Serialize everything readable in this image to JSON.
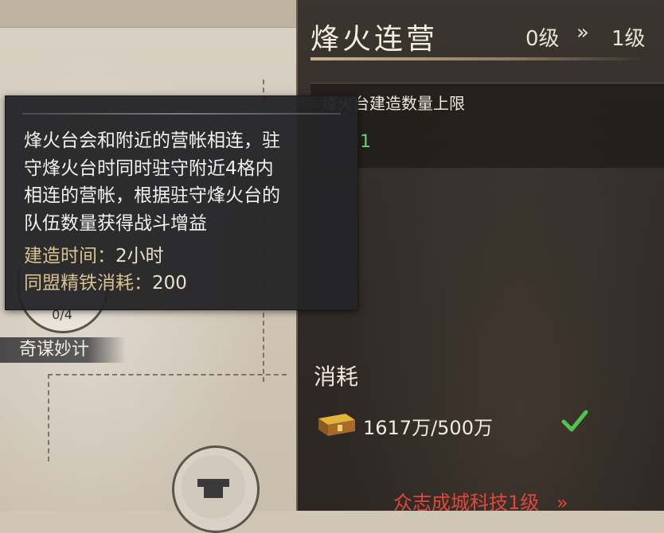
{
  "building": {
    "title": "烽火连营",
    "level_from": "0级",
    "arrow": "»",
    "level_to": "1级"
  },
  "attribute": {
    "name": "烽火台建造数量上限",
    "value": "1"
  },
  "cost": {
    "title": "消耗",
    "amount": "1617万/500万",
    "icon": "gold-chest-icon",
    "status_icon": "checkmark-icon"
  },
  "requirement": {
    "text": "众志成城科技1级",
    "arrow": "»"
  },
  "tooltip": {
    "description_lines": [
      "烽火台会和附近的营帐相连，驻",
      "守烽火台时同时驻守附近4格内",
      "相连的营帐，根据驻守烽火台的",
      "队伍数量获得战斗增益"
    ],
    "build_time_label": "建造时间：",
    "build_time_value": "2小时",
    "alliance_cost_label": "同盟精铁消耗：",
    "alliance_cost_value": "200"
  },
  "tree_node": {
    "name": "奇谋妙计",
    "progress": "0/4"
  },
  "colors": {
    "accent_green": "#6bd36b",
    "accent_red": "#e0473b",
    "tooltip_bg": "#242426"
  }
}
